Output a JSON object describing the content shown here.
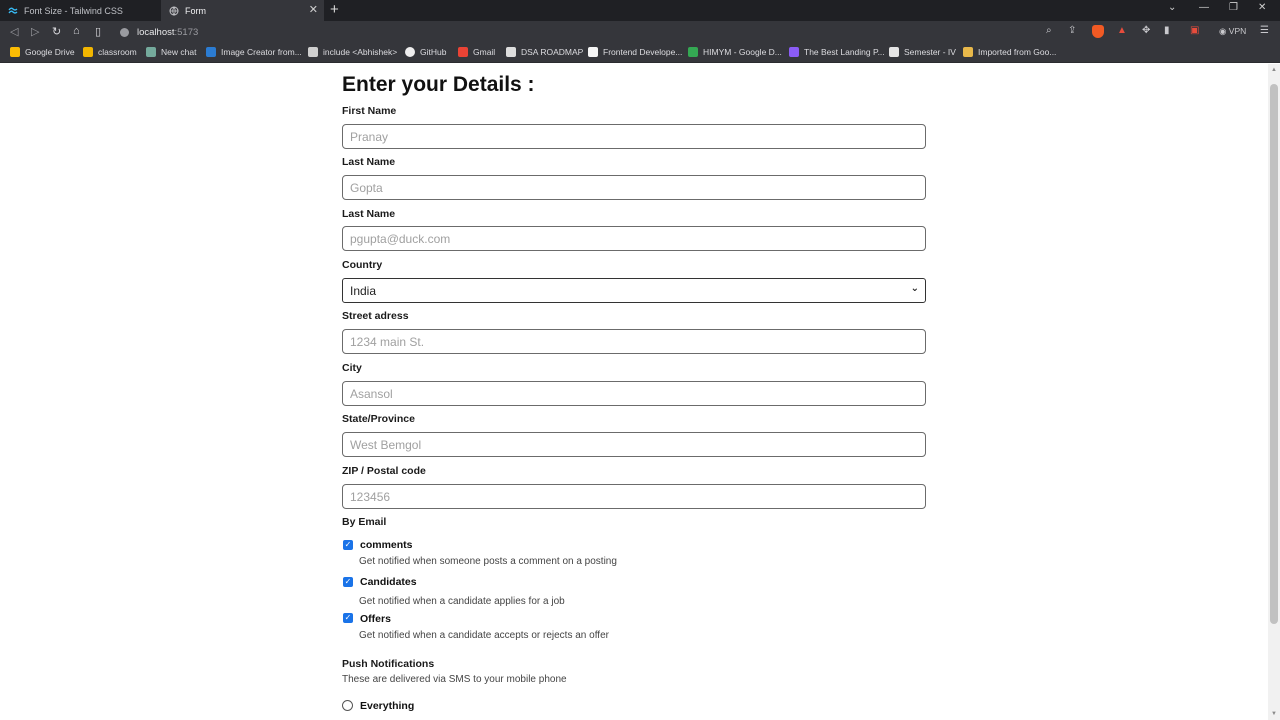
{
  "browser": {
    "tabs": [
      {
        "title": "Font Size - Tailwind CSS"
      },
      {
        "title": "Form"
      }
    ],
    "url": {
      "host": "localhost",
      "port": ":5173"
    },
    "vpn_label": "VPN",
    "bookmarks": [
      "Google Drive",
      "classroom",
      "New chat",
      "Image Creator from...",
      "include <Abhishek>",
      "GitHub",
      "Gmail",
      "DSA ROADMAP",
      "Frontend Develope...",
      "HIMYM - Google D...",
      "The Best Landing P...",
      "Semester - IV",
      "Imported from Goo..."
    ]
  },
  "form": {
    "title": "Enter your Details :",
    "fields": [
      {
        "label": "First Name",
        "placeholder": "Pranay"
      },
      {
        "label": "Last Name",
        "placeholder": "Gopta"
      },
      {
        "label": "Last Name",
        "placeholder": "pgupta@duck.com"
      },
      {
        "label": "Street adress",
        "placeholder": "1234 main St."
      },
      {
        "label": "City",
        "placeholder": "Asansol"
      },
      {
        "label": "State/Province",
        "placeholder": "West Bemgol"
      },
      {
        "label": "ZIP / Postal code",
        "placeholder": "123456"
      }
    ],
    "country": {
      "label": "Country",
      "value": "India"
    },
    "by_email": {
      "heading": "By Email",
      "options": [
        {
          "label": "comments",
          "description": "Get notified when someone posts a comment on a posting",
          "checked": true
        },
        {
          "label": "Candidates",
          "description": "Get notified when a candidate applies for a job",
          "checked": true
        },
        {
          "label": "Offers",
          "description": "Get notified when a candidate accepts or rejects an offer",
          "checked": true
        }
      ]
    },
    "push": {
      "heading": "Push Notifications",
      "description": "These are delivered via SMS to your mobile phone",
      "options": [
        {
          "label": "Everything",
          "selected": false
        }
      ]
    }
  },
  "colors": {
    "accent": "#1a73e8",
    "chrome_dark": "#1f2024",
    "chrome_mid": "#35363b"
  }
}
